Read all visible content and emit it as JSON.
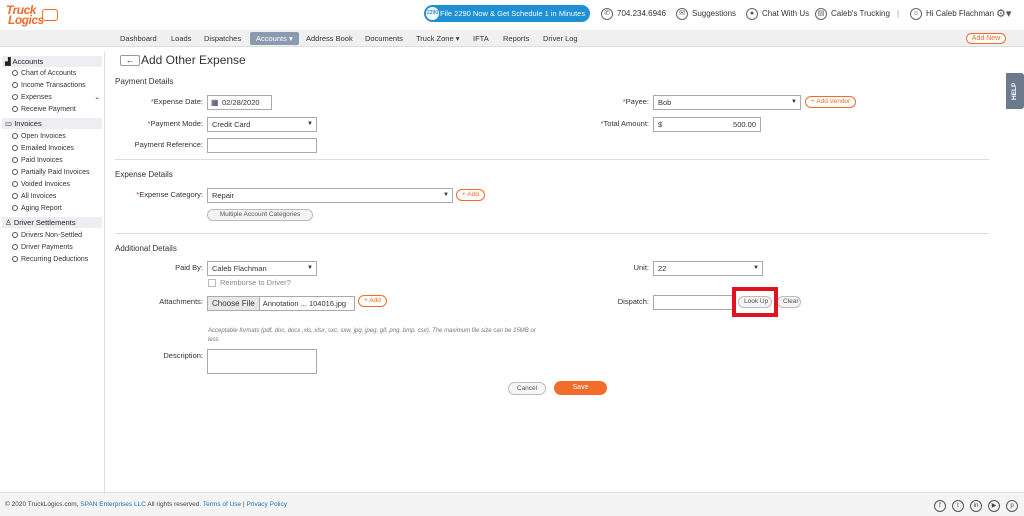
{
  "brand": {
    "logo_line1": "Truck",
    "logo_line2": "Logics"
  },
  "topbar": {
    "promo_badge": "2290",
    "promo": "File 2290 Now & Get Schedule 1 in Minutes",
    "phone": "704.234.6946",
    "suggestions": "Suggestions",
    "chat": "Chat With Us",
    "company": "Caleb's Trucking",
    "separator": "|",
    "greeting": "Hi Caleb Flachman"
  },
  "nav": {
    "items": [
      "Dashboard",
      "Loads",
      "Dispatches",
      "Accounts",
      "Address Book",
      "Documents",
      "Truck Zone",
      "IFTA",
      "Reports",
      "Driver Log"
    ],
    "active": "Accounts",
    "add_new": "Add New"
  },
  "sidebar": {
    "accounts_head": "Accounts",
    "accounts_items": [
      "Chart of Accounts",
      "Income Transactions",
      "Expenses",
      "Receive Payment"
    ],
    "invoices_head": "Invoices",
    "invoices_items": [
      "Open Invoices",
      "Emailed Invoices",
      "Paid Invoices",
      "Partially Paid Invoices",
      "Voided Invoices",
      "All Invoices",
      "Aging Report"
    ],
    "settlements_head": "Driver Settlements",
    "settlements_items": [
      "Drivers Non-Settled",
      "Driver Payments",
      "Recurring Deductions"
    ]
  },
  "page": {
    "title": "Add Other Expense",
    "back": "←"
  },
  "payment": {
    "section": "Payment Details",
    "expense_date_label": "Expense Date:",
    "expense_date": "02/28/2020",
    "payment_mode_label": "Payment Mode:",
    "payment_mode": "Credit Card",
    "payment_ref_label": "Payment Reference:",
    "payment_ref": "",
    "payee_label": "Payee:",
    "payee": "Bob",
    "add_vendor": "+ Add Vendor",
    "total_label": "Total Amount:",
    "currency": "$",
    "total": "500.00"
  },
  "expense": {
    "section": "Expense Details",
    "category_label": "Expense Category:",
    "category": "Repair",
    "add": "+ Add",
    "multiple": "Multiple Account Categories"
  },
  "additional": {
    "section": "Additional Details",
    "paid_by_label": "Paid By:",
    "paid_by": "Caleb Flachman",
    "reimburse": "Reimburse to Driver?",
    "attachments_label": "Attachments:",
    "choose_file": "Choose File",
    "file_name": "Annotation ... 104016.jpg",
    "add": "+ Add",
    "hint": "Acceptable formats (pdf, doc, docx ,xls, xlsx, sxc, sxw, jpg, jpeg, gif, png, bmp, csv). The maximum file size can be 15MB or less",
    "description_label": "Description:",
    "unit_label": "Unit:",
    "unit": "22",
    "dispatch_label": "Dispatch:",
    "dispatch": "",
    "lookup": "Look Up",
    "clear": "Clear"
  },
  "actions": {
    "cancel": "Cancel",
    "save": "Save"
  },
  "help": "HELP",
  "footer": {
    "copyright": "© 2020 TruckLogics.com,",
    "span": "SPAN Enterprises LLC",
    "rights": "All rights reserved.",
    "terms": "Terms of Use",
    "sep": "|",
    "privacy": "Privacy Policy"
  }
}
